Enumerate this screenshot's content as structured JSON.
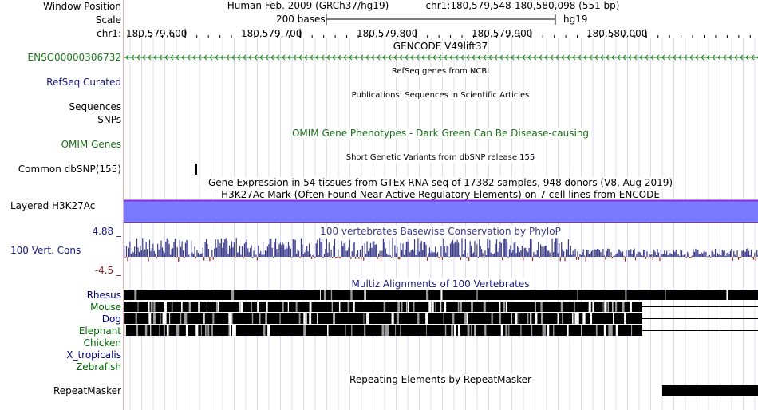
{
  "labels": {
    "window_position": "Window Position",
    "scale": "Scale",
    "chrom": "chr1:",
    "gene_id": "ENSG00000306732",
    "refseq": "RefSeq Curated",
    "sequences": "Sequences",
    "snps": "SNPs",
    "omim_genes": "OMIM Genes",
    "common_dbsnp": "Common dbSNP(155)",
    "layered_h3k27ac": "Layered H3K27Ac",
    "vert_cons": "100 Vert. Cons",
    "cons_max": "4.88 _",
    "cons_min": "-4.5 _",
    "species": [
      {
        "name": "Rhesus",
        "color": "#000080"
      },
      {
        "name": "Mouse",
        "color": "#006400"
      },
      {
        "name": "Dog",
        "color": "#000080"
      },
      {
        "name": "Elephant",
        "color": "#006400"
      },
      {
        "name": "Chicken",
        "color": "#006400"
      },
      {
        "name": "X_tropicalis",
        "color": "#000080"
      },
      {
        "name": "Zebrafish",
        "color": "#006400"
      }
    ],
    "repeatmasker": "RepeatMasker"
  },
  "header": {
    "assembly": "Human Feb. 2009 (GRCh37/hg19)",
    "position": "chr1:180,579,548-180,580,098 (551 bp)",
    "scale_text": "200 bases",
    "db": "hg19",
    "ticks": [
      "180,579,600",
      "180,579,700",
      "180,579,800",
      "180,579,900",
      "180,580,000"
    ]
  },
  "tracks": {
    "gencode": "GENCODE V49lift37",
    "refseq": "RefSeq genes from NCBI",
    "publications": "Publications: Sequences in Scientific Articles",
    "omim": "OMIM Gene Phenotypes - Dark Green Can Be Disease-causing",
    "dbsnp": "Short Genetic Variants from dbSNP release 155",
    "gtex": "Gene Expression in 54 tissues from GTEx RNA-seq of 17382 samples, 948 donors (V8, Aug 2019)",
    "h3k27ac": "H3K27Ac Mark (Often Found Near Active Regulatory Elements) on 7 cell lines from ENCODE",
    "phylop": "100 vertebrates Basewise Conservation by PhyloP",
    "multiz": "Multiz Alignments of 100 Vertebrates",
    "repeats": "Repeating Elements by RepeatMasker"
  },
  "colors": {
    "gencode": "#1a7a1a",
    "label_blue": "#1a1a80",
    "omim": "#1a6e1a",
    "h3k27ac_fill": "#7a7aff",
    "h3k27ac_border": "#8a2be2",
    "phylop": "#3a3a8a",
    "phylop_neg": "#8b2020",
    "grid": "#d8d8ec"
  }
}
